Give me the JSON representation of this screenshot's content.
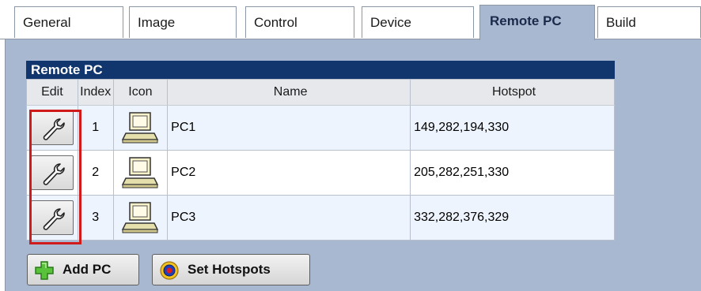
{
  "tabs": [
    "General",
    "Image",
    "Control",
    "Device",
    "Remote PC",
    "Build"
  ],
  "active_tab": "Remote PC",
  "grid": {
    "caption": "Remote PC",
    "columns": {
      "edit": "Edit",
      "index": "Index",
      "icon": "Icon",
      "name": "Name",
      "hotspot": "Hotspot"
    },
    "rows": [
      {
        "index": "1",
        "name": "PC1",
        "hotspot": "149,282,194,330"
      },
      {
        "index": "2",
        "name": "PC2",
        "hotspot": "205,282,251,330"
      },
      {
        "index": "3",
        "name": "PC3",
        "hotspot": "332,282,376,329"
      }
    ]
  },
  "buttons": {
    "add_pc": "Add PC",
    "set_hotspots": "Set Hotspots"
  },
  "icons": {
    "edit": "wrench-icon",
    "pc": "computer-icon",
    "add": "green-plus-icon",
    "hotspot": "target-icon"
  },
  "colors": {
    "panel_bg": "#a8b8d1",
    "caption_bg": "#10366d",
    "highlight_frame": "#d11a1a"
  }
}
